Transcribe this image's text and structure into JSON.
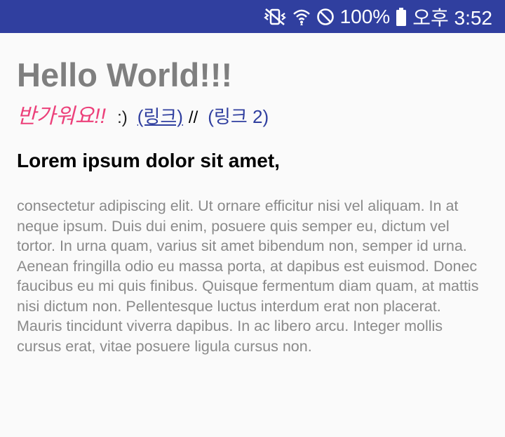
{
  "status_bar": {
    "battery_percent": "100%",
    "time": "오후 3:52",
    "icons": [
      "vibrate-mute-icon",
      "wifi-icon",
      "do-not-disturb-icon",
      "battery-icon"
    ]
  },
  "main": {
    "heading": "Hello World!!!",
    "greeting": "반가워요!!",
    "smile": ":)",
    "link_1": "(링크)",
    "separator": "//",
    "link_2": "(링크 2)",
    "lorem_title": "Lorem ipsum dolor sit amet,",
    "lorem_body": "consectetur adipiscing elit. Ut ornare efficitur nisi vel aliquam. In at neque ipsum. Duis dui enim, posuere quis semper eu, dictum vel tortor. In urna quam, varius sit amet bibendum non, semper id urna. Aenean fringilla odio eu massa porta, at dapibus est euismod. Donec faucibus eu mi quis finibus. Quisque fermentum diam quam, at mattis nisi dictum non. Pellentesque luctus interdum erat non placerat. Mauris tincidunt viverra dapibus. In ac libero arcu. Integer mollis cursus erat, vitae posuere ligula cursus non."
  },
  "colors": {
    "status_bar": "#303f9f",
    "greeting": "#ec407a",
    "link": "#303f9f",
    "heading": "#7f7f7f",
    "body_text": "#8a8a8a"
  }
}
